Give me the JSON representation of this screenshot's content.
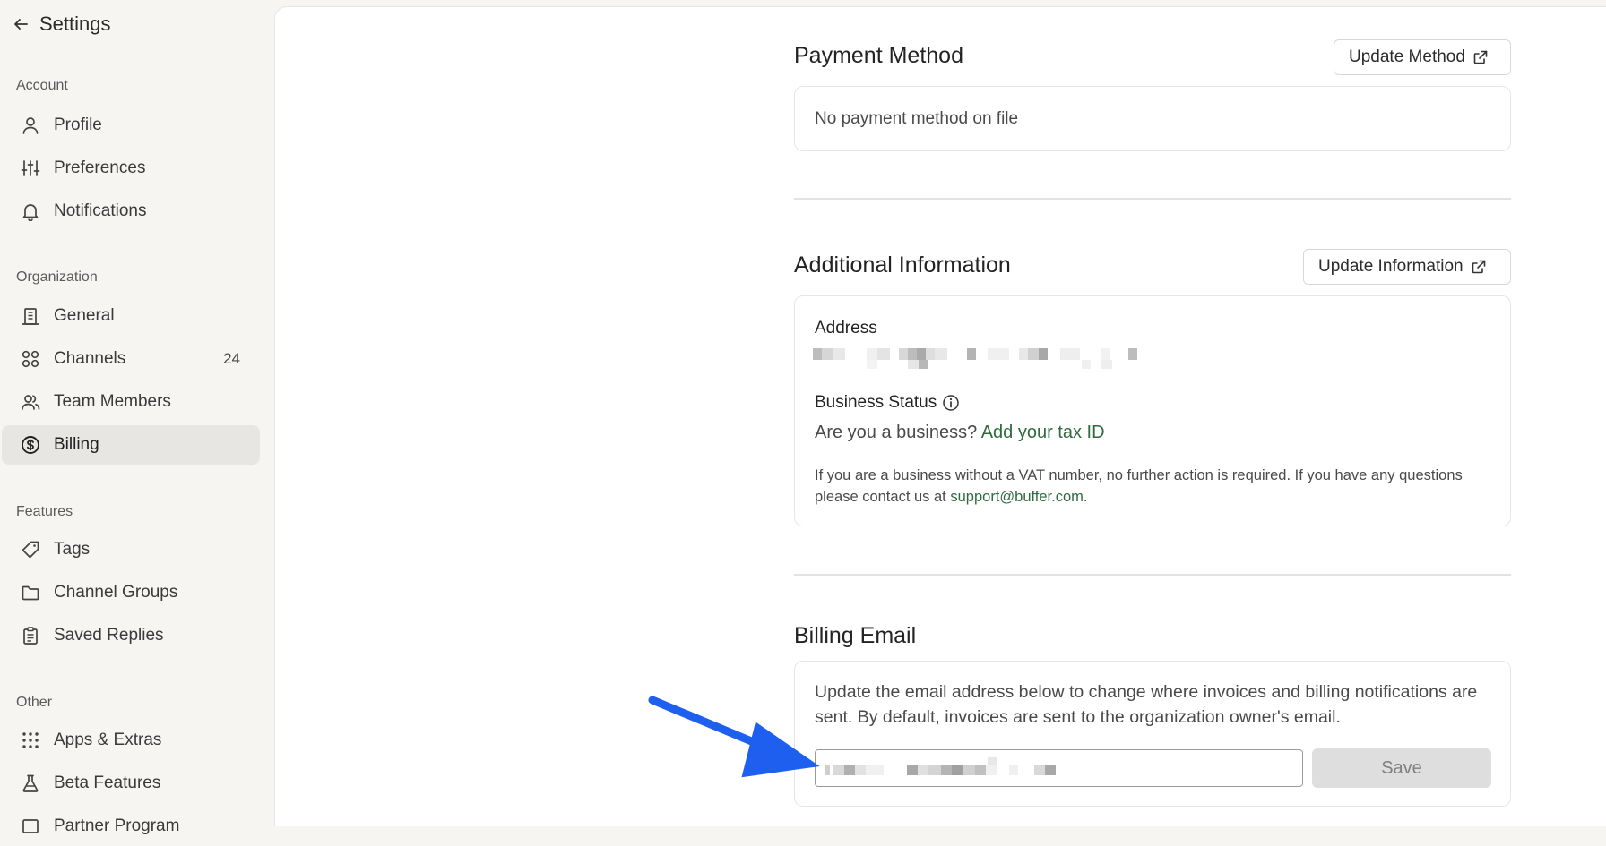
{
  "sidebar": {
    "title": "Settings",
    "sections": {
      "account": "Account",
      "organization": "Organization",
      "features": "Features",
      "other": "Other"
    },
    "items": {
      "profile": "Profile",
      "preferences": "Preferences",
      "notifications": "Notifications",
      "general": "General",
      "channels": "Channels",
      "channels_count": "24",
      "team_members": "Team Members",
      "billing": "Billing",
      "tags": "Tags",
      "channel_groups": "Channel Groups",
      "saved_replies": "Saved Replies",
      "apps_extras": "Apps & Extras",
      "beta_features": "Beta Features",
      "partner_program": "Partner Program"
    }
  },
  "payment_method": {
    "title": "Payment Method",
    "button": "Update Method",
    "empty_text": "No payment method on file"
  },
  "additional_info": {
    "title": "Additional Information",
    "button": "Update Information",
    "address_label": "Address",
    "business_status_label": "Business Status",
    "business_question": "Are you a business?",
    "tax_link": "Add your tax ID",
    "vat_note": "If you are a business without a VAT number, no further action is required. If you have any questions please contact us at",
    "support_email": "support@buffer.com",
    "period": "."
  },
  "billing_email": {
    "title": "Billing Email",
    "description": "Update the email address below to change where invoices and billing notifications are sent. By default, invoices are sent to the organization owner's email.",
    "save_label": "Save"
  },
  "colors": {
    "accent_green": "#2f6b3f",
    "arrow_blue": "#1f5ff0",
    "active_bg": "#e8e6e2"
  }
}
